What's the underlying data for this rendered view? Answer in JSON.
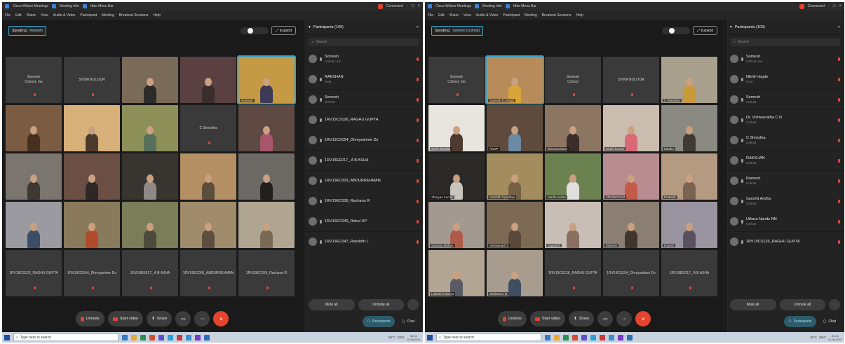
{
  "screens": [
    {
      "window": {
        "title_items": [
          "Cisco Webex Meetings",
          "Meeting Info",
          "Hide Menu Bar"
        ],
        "connected_label": "Connected",
        "window_controls": [
          "-",
          "□",
          "×"
        ]
      },
      "menu": [
        "File",
        "Edit",
        "Share",
        "View",
        "Audio & Video",
        "Participant",
        "Meeting",
        "Breakout Sessions",
        "Help"
      ],
      "stage": {
        "speaking_label": "Speaking:",
        "speaking_name": "Ramesh",
        "expand_label": "Expand",
        "slider_position": 0.3
      },
      "tiles": [
        {
          "kind": "name",
          "label": "Somesh",
          "sub": "Cohost, me"
        },
        {
          "kind": "name",
          "label": "SHIVA BOLOOR"
        },
        {
          "kind": "video",
          "bg": "#7a6a58",
          "fg": "#2d2a2a"
        },
        {
          "kind": "video",
          "bg": "#5a4040",
          "fg": "#3a2d2b"
        },
        {
          "kind": "video",
          "bg": "#c49a45",
          "fg": "#3c3a55",
          "active": true,
          "caption": "Ramesh"
        },
        {
          "kind": "video",
          "bg": "#7b5c43",
          "fg": "#463120"
        },
        {
          "kind": "video",
          "bg": "#d8b07a",
          "fg": "#4c3b2b"
        },
        {
          "kind": "video",
          "bg": "#8d8f58",
          "fg": "#56705a"
        },
        {
          "kind": "name",
          "label": "C Shrestha"
        },
        {
          "kind": "video",
          "bg": "#5e4a42",
          "fg": "#a8566b"
        },
        {
          "kind": "video",
          "bg": "#7a756e",
          "fg": "#3d3833"
        },
        {
          "kind": "video",
          "bg": "#6b4f44",
          "fg": "#2f2626"
        },
        {
          "kind": "video",
          "bg": "#38342f",
          "fg": "#8f8a86"
        },
        {
          "kind": "video",
          "bg": "#b38f63",
          "fg": "#5d4d3d"
        },
        {
          "kind": "video",
          "bg": "#6d6a66",
          "fg": "#221f1f"
        },
        {
          "kind": "video",
          "bg": "#9a9aa0",
          "fg": "#3b4e66"
        },
        {
          "kind": "video",
          "bg": "#8a7a5c",
          "fg": "#b24a2c"
        },
        {
          "kind": "video",
          "bg": "#7b7c58",
          "fg": "#4b4a3b"
        },
        {
          "kind": "video",
          "bg": "#a08b6b",
          "fg": "#5e4e3e"
        },
        {
          "kind": "video",
          "bg": "#b0a591",
          "fg": "#7a6a55"
        },
        {
          "kind": "name",
          "label": "1RV19CS126_RAGHU GUPTA"
        },
        {
          "kind": "name",
          "label": "1RV19CS154_Dhreyashree Ds"
        },
        {
          "kind": "name",
          "label": "1RV18EE017_ A B ASHA"
        },
        {
          "kind": "name",
          "label": "1RV19EC003_ABDURREHMAN"
        },
        {
          "kind": "name",
          "label": "1RV19EC039_Rachana R"
        }
      ],
      "controls": [
        "Unmute",
        "Start video",
        "Share"
      ],
      "panel": {
        "title": "Participants (109)",
        "search_placeholder": "Search",
        "participants": [
          {
            "name": "Somesh",
            "role": "Cohost, me"
          },
          {
            "name": "RAKSHAN",
            "role": "Host"
          },
          {
            "name": "Somesh",
            "role": "Cohost"
          },
          {
            "name": "1RV19CS126_RAGHU GUPTA",
            "role": ""
          },
          {
            "name": "1RV19CS154_Dhreyashree Ds",
            "role": ""
          },
          {
            "name": "1RV18EE017_ A B ASHA",
            "role": ""
          },
          {
            "name": "1RV19EC003_ABDURREHMAN",
            "role": ""
          },
          {
            "name": "1RV19EC039_Rachana R",
            "role": ""
          },
          {
            "name": "1RV19EC040_Rahul HP",
            "role": ""
          },
          {
            "name": "1RV19EC047_Rakshith L",
            "role": ""
          }
        ],
        "mute_all": "Mute all",
        "unmute_all": "Unmute all",
        "tab_participants": "Participants",
        "tab_chat": "Chat"
      },
      "taskbar": {
        "search_placeholder": "Type here to search",
        "weather": "26°C",
        "lang": "ENG",
        "time": "09:41",
        "date": "11-06-2021"
      }
    },
    {
      "window": {
        "title_items": [
          "Cisco Webex Meetings",
          "Meeting Info",
          "Hide Menu Bar"
        ],
        "connected_label": "Connected",
        "window_controls": [
          "-",
          "□",
          "×"
        ]
      },
      "menu": [
        "File",
        "Edit",
        "Share",
        "View",
        "Audio & Video",
        "Participant",
        "Meeting",
        "Breakout Sessions",
        "Help"
      ],
      "stage": {
        "speaking_label": "Speaking:",
        "speaking_name": "Somesh (Cohost)",
        "expand_label": "Expand",
        "slider_position": 0.3
      },
      "tiles": [
        {
          "kind": "name",
          "label": "Somesh",
          "sub": "Cohost, me"
        },
        {
          "kind": "video",
          "bg": "#b88c5a",
          "fg": "#d8a53a",
          "active": true,
          "caption": "Somesh (Cohost)"
        },
        {
          "kind": "name",
          "label": "Somesh",
          "sub": "Cohost"
        },
        {
          "kind": "name",
          "label": "SHIVA BOLOOR"
        },
        {
          "kind": "video",
          "bg": "#a89f8c",
          "fg": "#c89a3a",
          "caption": "C Shrestha"
        },
        {
          "kind": "video",
          "bg": "#e8e4de",
          "fg": "#4d3b30",
          "caption": "Sneh Nandita"
        },
        {
          "kind": "video",
          "bg": "#5e4b3d",
          "fg": "#6d8aa5",
          "caption": "ANUP"
        },
        {
          "kind": "video",
          "bg": "#8c7662",
          "fg": "#3a2e2a",
          "caption": "Bhuvaneswari"
        },
        {
          "kind": "video",
          "bg": "#cbbcb0",
          "fg": "#d86a78",
          "caption": "Sruthi Kumar"
        },
        {
          "kind": "video",
          "bg": "#8a8a82",
          "fg": "#3f3a35",
          "caption": "Madhu"
        },
        {
          "kind": "video",
          "bg": "#2c2a28",
          "fg": "#c8c4be",
          "caption": "Shreyas Kumar"
        },
        {
          "kind": "video",
          "bg": "#a38d5f",
          "fg": "#756046",
          "caption": "Harshith Upadhya"
        },
        {
          "kind": "video",
          "bg": "#6c8150",
          "fg": "#e0e0dc",
          "caption": "Madhusudan"
        },
        {
          "kind": "video",
          "bg": "#b88c90",
          "fg": "#c45a48",
          "caption": "1RV19CS154"
        },
        {
          "kind": "video",
          "bg": "#b59a82",
          "fg": "#7a6350",
          "caption": "Prakash"
        },
        {
          "kind": "video",
          "bg": "#a29a91",
          "fg": "#b05a4a",
          "caption": "Soumya Mohan"
        },
        {
          "kind": "video",
          "bg": "#7d6a55",
          "fg": "#5a4838",
          "caption": "Vishwanath S"
        },
        {
          "kind": "video",
          "bg": "#c8beb5",
          "fg": "#8a6f60",
          "caption": "Jagadish"
        },
        {
          "kind": "video",
          "bg": "#8a7f72",
          "fg": "#40352f",
          "caption": "Mahesh"
        },
        {
          "kind": "video",
          "bg": "#9a93a0",
          "fg": "#5a5060",
          "caption": "Rajesh"
        },
        {
          "kind": "video",
          "bg": "#b3a594",
          "fg": "#5a5a66",
          "caption": "Lokesh Acharya"
        },
        {
          "kind": "video",
          "bg": "#a89c8e",
          "fg": "#3f4d62",
          "caption": "Srinivas C N"
        },
        {
          "kind": "name",
          "label": "1RV19CS126_RAGHU GUPTA"
        },
        {
          "kind": "name",
          "label": "1RV19CS154_Dhreyashree Ds"
        },
        {
          "kind": "name",
          "label": "1RV18EE017_ A B ASHA"
        }
      ],
      "controls": [
        "Unmute",
        "Start video",
        "Share"
      ],
      "panel": {
        "title": "Participants (109)",
        "search_placeholder": "Search",
        "participants": [
          {
            "name": "Somesh",
            "role": "Cohost, me"
          },
          {
            "name": "Nikhil Hegde",
            "role": "Host"
          },
          {
            "name": "Somesh",
            "role": "Cohost"
          },
          {
            "name": "Dr. Vishwanatha C N",
            "role": "Cohost"
          },
          {
            "name": "C Shrestha",
            "role": "Cohost"
          },
          {
            "name": "RAKSHAN",
            "role": "Cohost"
          },
          {
            "name": "Ramesh",
            "role": "Cohost"
          },
          {
            "name": "Sanchit Andhu",
            "role": "Cohost"
          },
          {
            "name": "Uthara Nandu NN",
            "role": "Cohost"
          },
          {
            "name": "1RV19CS126_RAGHU GUPTA",
            "role": ""
          }
        ],
        "mute_all": "Mute all",
        "unmute_all": "Unmute all",
        "tab_participants": "Participants",
        "tab_chat": "Chat"
      },
      "taskbar": {
        "search_placeholder": "Type here to search",
        "weather": "26°C",
        "lang": "ENG",
        "time": "09:41",
        "date": "11-06-2021"
      }
    }
  ],
  "taskbar_icon_colors": [
    "#3a78c8",
    "#e8a93a",
    "#2f8f4f",
    "#d84a32",
    "#5a4fd0",
    "#2aa0d8",
    "#c83a3a",
    "#3a8fd0",
    "#7a3ac8",
    "#2a6fb8"
  ]
}
